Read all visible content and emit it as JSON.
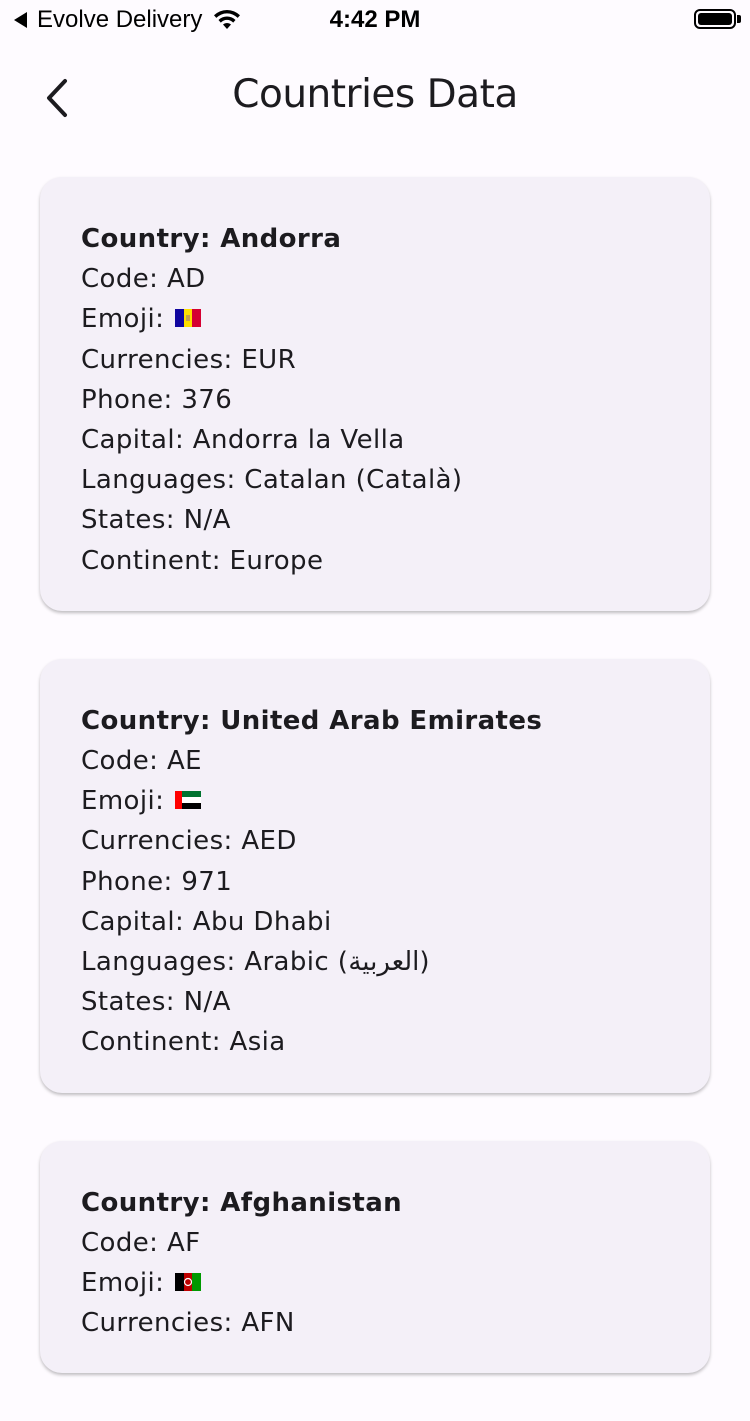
{
  "status_bar": {
    "carrier": "Evolve Delivery",
    "time": "4:42 PM"
  },
  "app_bar": {
    "title": "Countries Data"
  },
  "countries": [
    {
      "name": "Country: Andorra",
      "code": "Code: AD",
      "emoji_label": "Emoji:",
      "flag": "andorra-flag-icon",
      "currencies": "Currencies: EUR",
      "phone": "Phone: 376",
      "capital": "Capital: Andorra la Vella",
      "languages": "Languages: Catalan (Català)",
      "states": "States: N/A",
      "continent": "Continent: Europe"
    },
    {
      "name": "Country: United Arab Emirates",
      "code": "Code: AE",
      "emoji_label": "Emoji:",
      "flag": "uae-flag-icon",
      "currencies": "Currencies: AED",
      "phone": "Phone: 971",
      "capital": "Capital: Abu Dhabi",
      "languages": "Languages: Arabic (العربية)",
      "states": "States: N/A",
      "continent": "Continent: Asia"
    },
    {
      "name": "Country: Afghanistan",
      "code": "Code: AF",
      "emoji_label": "Emoji:",
      "flag": "afghanistan-flag-icon",
      "currencies": "Currencies: AFN",
      "phone": "",
      "capital": "",
      "languages": "",
      "states": "",
      "continent": ""
    }
  ],
  "colors": {
    "background": "#fefbff",
    "card": "#f4f0f8",
    "text": "#1c1b1f"
  }
}
